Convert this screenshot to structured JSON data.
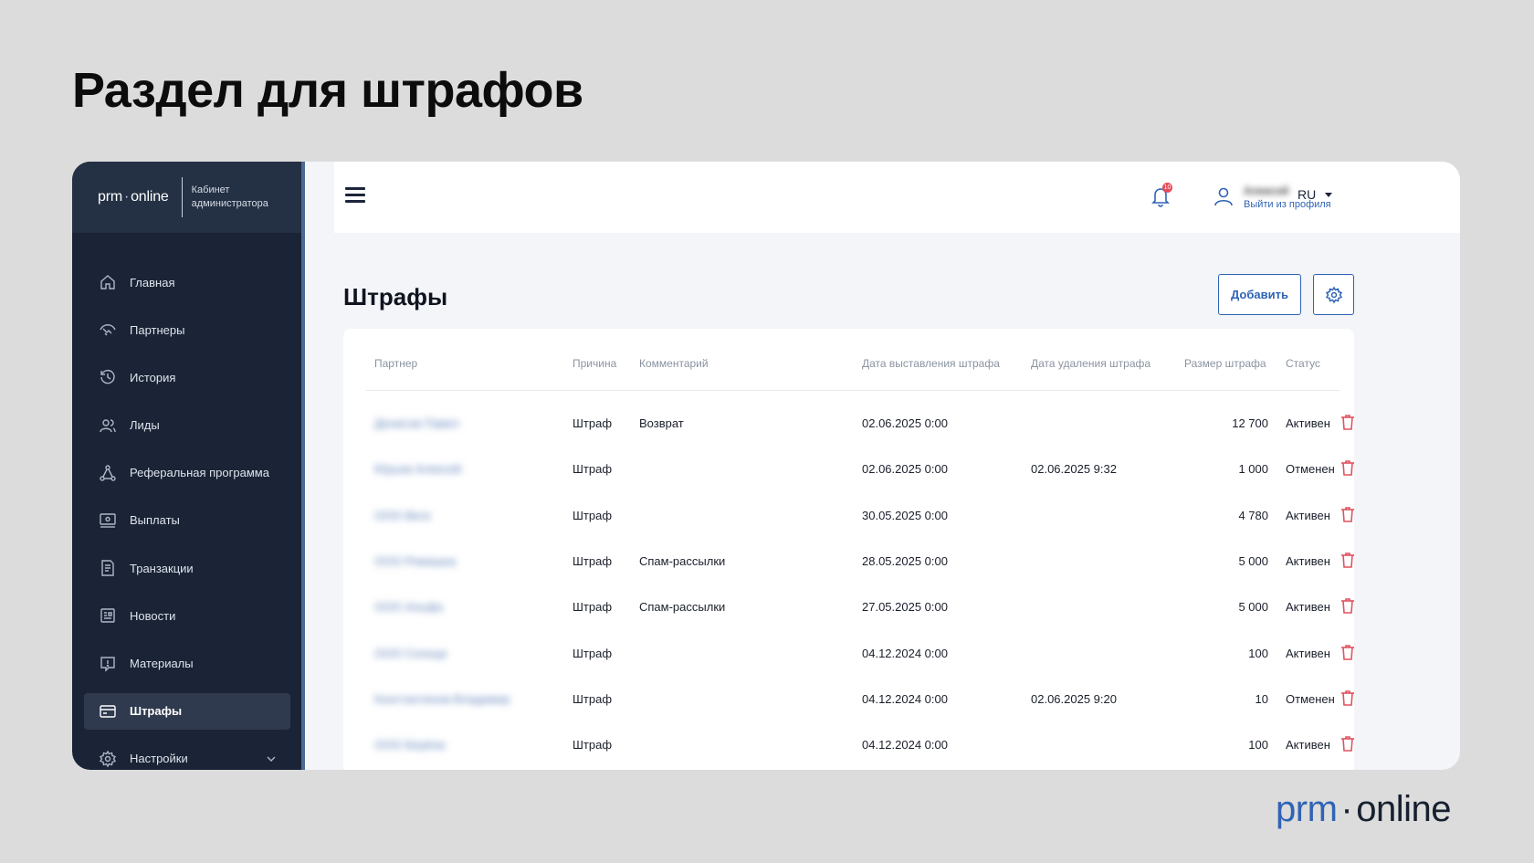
{
  "slide": {
    "title": "Раздел для штрафов"
  },
  "brand": {
    "prm": "prm",
    "dot": "·",
    "online": "online"
  },
  "sidebar": {
    "logo_prm": "prm",
    "logo_dot": "·",
    "logo_online": "online",
    "subtitle": "Кабинет администратора",
    "items": [
      {
        "label": "Главная",
        "icon": "home-icon"
      },
      {
        "label": "Партнеры",
        "icon": "handshake-icon"
      },
      {
        "label": "История",
        "icon": "history-icon"
      },
      {
        "label": "Лиды",
        "icon": "users-icon"
      },
      {
        "label": "Реферальная программа",
        "icon": "referral-icon"
      },
      {
        "label": "Выплаты",
        "icon": "payouts-icon"
      },
      {
        "label": "Транзакции",
        "icon": "receipt-icon"
      },
      {
        "label": "Новости",
        "icon": "news-icon"
      },
      {
        "label": "Материалы",
        "icon": "materials-icon"
      },
      {
        "label": "Штрафы",
        "icon": "card-icon",
        "active": true
      },
      {
        "label": "Настройки",
        "icon": "gear-icon"
      }
    ]
  },
  "topbar": {
    "notifications_count": "10",
    "user_name": "Алексей",
    "logout_label": "Выйти из профиля",
    "language": "RU"
  },
  "page": {
    "title": "Штрафы",
    "add_label": "Добавить"
  },
  "table": {
    "headers": [
      "Партнер",
      "Причина",
      "Комментарий",
      "Дата выставления штрафа",
      "Дата удаления штрафа",
      "Размер штрафа",
      "Статус"
    ],
    "rows": [
      {
        "partner": "Денисов Павел",
        "reason": "Штраф",
        "comment": "Возврат",
        "issued": "02.06.2025 0:00",
        "removed": "",
        "amount": "12 700",
        "status": "Активен"
      },
      {
        "partner": "Юрьев Алексей",
        "reason": "Штраф",
        "comment": "",
        "issued": "02.06.2025 0:00",
        "removed": "02.06.2025 9:32",
        "amount": "1 000",
        "status": "Отменен"
      },
      {
        "partner": "ООО Вега",
        "reason": "Штраф",
        "comment": "",
        "issued": "30.05.2025 0:00",
        "removed": "",
        "amount": "4 780",
        "status": "Активен"
      },
      {
        "partner": "ООО Ромашка",
        "reason": "Штраф",
        "comment": "Спам-рассылки",
        "issued": "28.05.2025 0:00",
        "removed": "",
        "amount": "5 000",
        "status": "Активен"
      },
      {
        "partner": "ООО Альфа",
        "reason": "Штраф",
        "comment": "Спам-рассылки",
        "issued": "27.05.2025 0:00",
        "removed": "",
        "amount": "5 000",
        "status": "Активен"
      },
      {
        "partner": "ООО Солнце",
        "reason": "Штраф",
        "comment": "",
        "issued": "04.12.2024 0:00",
        "removed": "",
        "amount": "100",
        "status": "Активен"
      },
      {
        "partner": "Константинов Владимир",
        "reason": "Штраф",
        "comment": "",
        "issued": "04.12.2024 0:00",
        "removed": "02.06.2025 9:20",
        "amount": "10",
        "status": "Отменен"
      },
      {
        "partner": "ООО Берёза",
        "reason": "Штраф",
        "comment": "",
        "issued": "04.12.2024 0:00",
        "removed": "",
        "amount": "100",
        "status": "Активен"
      }
    ]
  },
  "colors": {
    "accent": "#2f63b5",
    "sidebar": "#1a2436",
    "danger": "#e0525f"
  }
}
